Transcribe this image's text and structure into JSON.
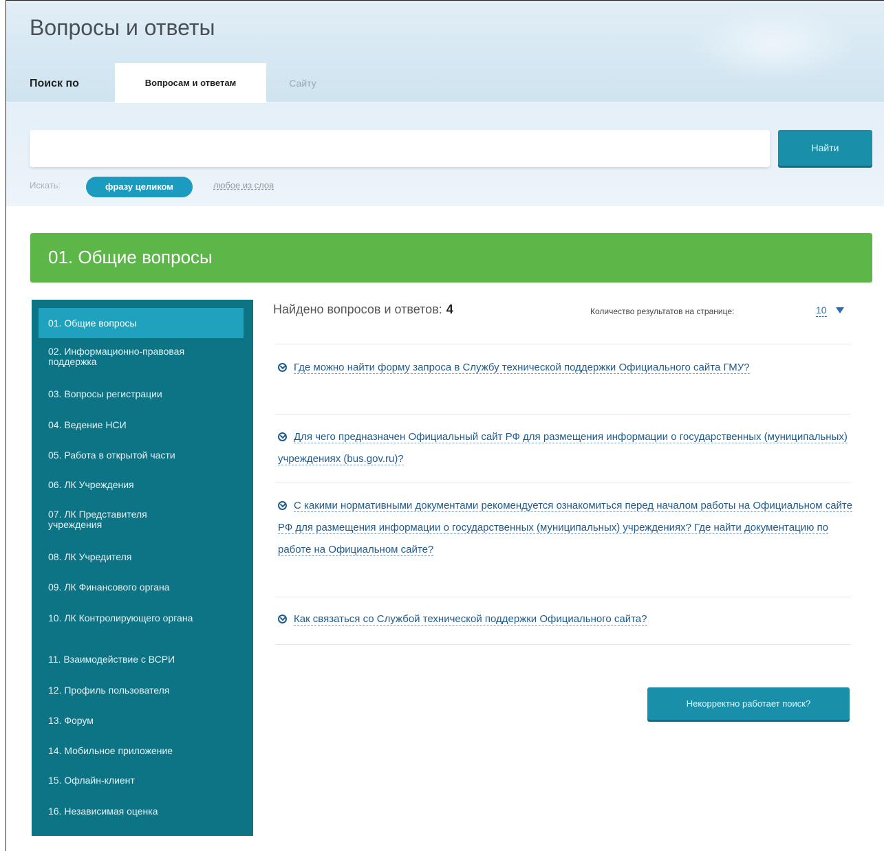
{
  "header": {
    "title": "Вопросы и ответы",
    "search_by_label": "Поиск по",
    "tabs": [
      {
        "label": "Вопросам и ответам",
        "active": true
      },
      {
        "label": "Сайту",
        "active": false
      }
    ]
  },
  "search": {
    "value": "",
    "placeholder": "",
    "button_label": "Найти",
    "mode_label": "Искать:",
    "mode_options": [
      {
        "label": "фразу целиком",
        "selected": true
      },
      {
        "label": "любое из слов",
        "selected": false
      }
    ]
  },
  "section": {
    "title": "01. Общие вопросы"
  },
  "sidebar": {
    "items": [
      {
        "label": "01. Общие вопросы",
        "active": true
      },
      {
        "label": "02. Информационно-правовая поддержка",
        "active": false
      },
      {
        "label": "03. Вопросы регистрации",
        "active": false
      },
      {
        "label": "04. Ведение НСИ",
        "active": false
      },
      {
        "label": "05. Работа в открытой части",
        "active": false
      },
      {
        "label": "06. ЛК Учреждения",
        "active": false
      },
      {
        "label": "07. ЛК Представителя учреждения",
        "active": false
      },
      {
        "label": "08. ЛК Учредителя",
        "active": false
      },
      {
        "label": "09. ЛК Финансового органа",
        "active": false
      },
      {
        "label": "10. ЛК Контролирующего органа",
        "active": false
      },
      {
        "label": "11. Взаимодействие с ВСРИ",
        "active": false
      },
      {
        "label": "12. Профиль пользователя",
        "active": false
      },
      {
        "label": "13. Форум",
        "active": false
      },
      {
        "label": "14. Мобильное приложение",
        "active": false
      },
      {
        "label": "15. Офлайн-клиент",
        "active": false
      },
      {
        "label": "16. Независимая оценка",
        "active": false
      }
    ]
  },
  "results": {
    "found_label": "Найдено вопросов и ответов:",
    "found_count": "4",
    "per_page_label": "Количество результатов на странице:",
    "per_page_value": "10",
    "questions": [
      "Где можно найти форму запроса в Службу технической поддержки Официального сайта ГМУ?",
      "Для чего предназначен Официальный сайт РФ для размещения информации о государственных (муниципальных) учреждениях (bus.gov.ru)?",
      "С какими нормативными документами рекомендуется ознакомиться перед началом работы на Официальном сайте РФ для размещения информации о государственных (муниципальных) учреждениях? Где найти документацию по работе на Официальном сайте?",
      "Как связаться со Службой технической поддержки Официального сайта?"
    ],
    "broken_search_label": "Некорректно работает поиск?"
  },
  "colors": {
    "section_green": "#5cb648",
    "sidebar_teal": "#0d7485",
    "active_item": "#1ea2bd",
    "button_teal": "#1a8fa9",
    "link_blue": "#1e5b8f"
  }
}
